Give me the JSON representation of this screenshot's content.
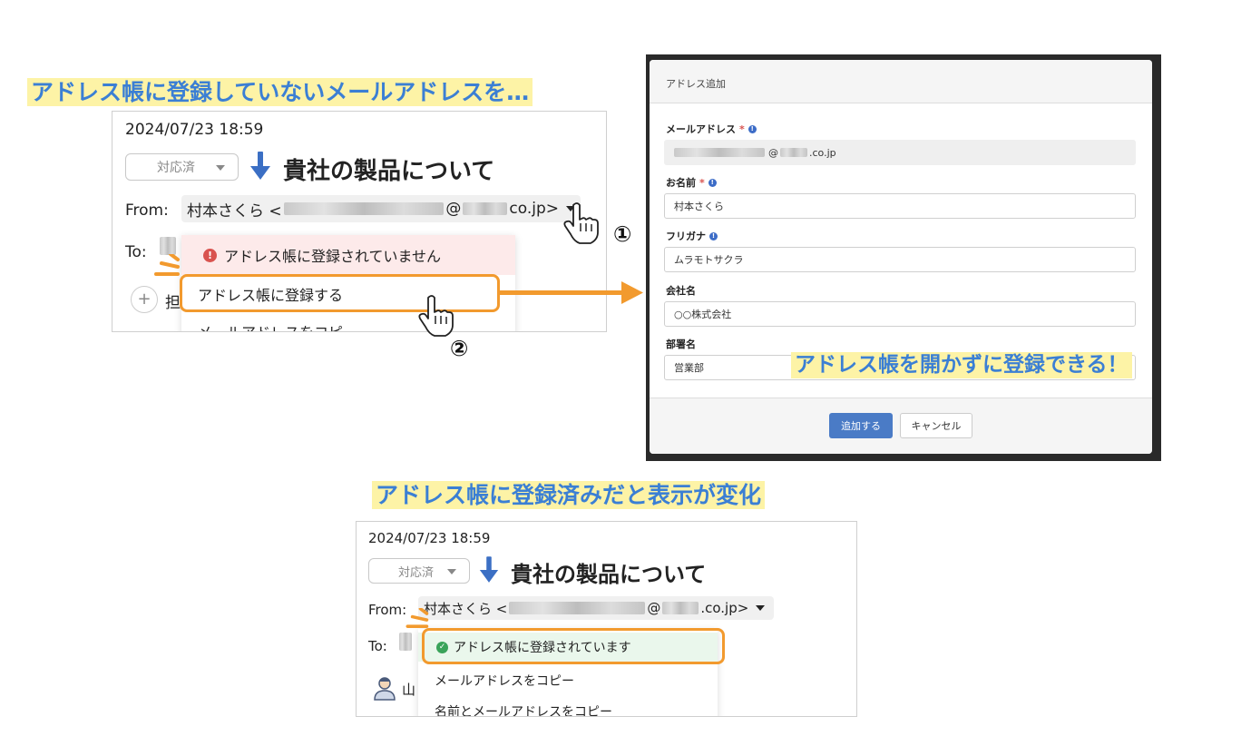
{
  "captions": {
    "top_left": "アドレス帳に登録していないメールアドレスを…",
    "right": "アドレス帳を開かずに登録できる！",
    "bottom": "アドレス帳に登録済みだと表示が変化"
  },
  "step_markers": {
    "one": "①",
    "two": "②"
  },
  "mail_before": {
    "date": "2024/07/23 18:59",
    "status": "対応済",
    "subject": "貴社の製品について",
    "from_label": "From:",
    "from_name": "村本さくら <",
    "from_domain": "co.jp>",
    "to_label": "To:",
    "assign_plus": "+",
    "assign_partial": "担",
    "menu": {
      "warning": "アドレス帳に登録されていません",
      "register": "アドレス帳に登録する",
      "copy_partial": "メールアドレスをコピー"
    }
  },
  "dialog": {
    "title": "アドレス追加",
    "email_label": "メールアドレス",
    "email_value_domain": ".co.jp",
    "name_label": "お名前",
    "name_value": "村本さくら",
    "furigana_label": "フリガナ",
    "furigana_value": "ムラモトサクラ",
    "company_label": "会社名",
    "company_value": "○○株式会社",
    "dept_label": "部署名",
    "dept_value": "営業部",
    "required_mark": "*",
    "info_mark": "!",
    "add_button": "追加する",
    "cancel_button": "キャンセル"
  },
  "mail_after": {
    "date": "2024/07/23 18:59",
    "status": "対応済",
    "subject": "貴社の製品について",
    "from_label": "From:",
    "from_name": "村本さくら <",
    "from_at": "@",
    "from_domain": ".co.jp>",
    "to_label": "To:",
    "assignee_partial": "山",
    "menu": {
      "registered": "アドレス帳に登録されています",
      "copy_email": "メールアドレスをコピー",
      "copy_name_partial": "名前とメールアドレスをコピー"
    }
  },
  "colors": {
    "caption_text": "#3b7fd4",
    "caption_highlight": "#fdf3a6",
    "orange": "#f29a2e",
    "primary_button": "#4a7bc6",
    "success": "#3aa35a",
    "error": "#d9534f"
  }
}
